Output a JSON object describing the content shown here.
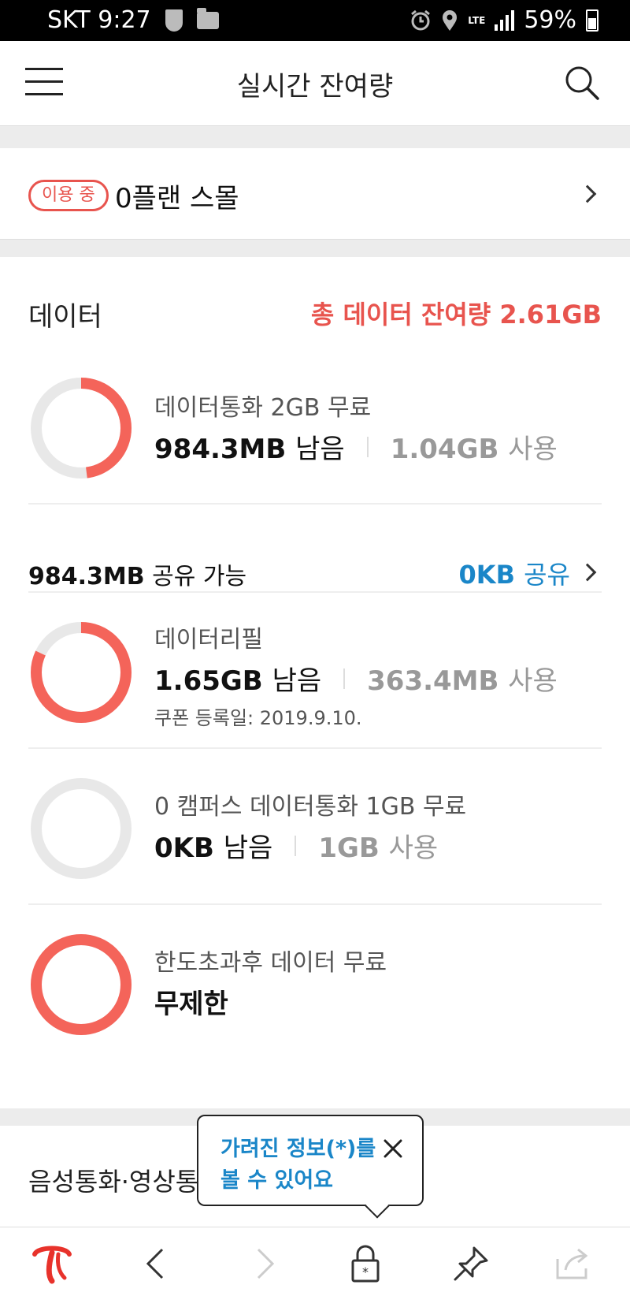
{
  "status_bar": {
    "carrier": "SKT",
    "time": "9:27",
    "network": "LTE",
    "battery": "59%",
    "icons": [
      "shield-icon",
      "folder-icon",
      "alarm-icon",
      "location-icon",
      "signal-icon",
      "battery-icon"
    ]
  },
  "header": {
    "title": "실시간 잔여량",
    "menu_icon": "menu-icon",
    "search_icon": "search-icon"
  },
  "plan": {
    "badge": "이용 중",
    "name": "0플랜 스몰"
  },
  "data": {
    "section_title": "데이터",
    "total_remaining": "총 데이터 잔여량 2.61GB",
    "items": [
      {
        "name": "데이터통화 2GB 무료",
        "remaining": "984.3MB",
        "remaining_suffix": "남음",
        "used": "1.04GB",
        "used_suffix": "사용",
        "remaining_fraction": 0.48
      },
      {
        "name": "데이터리필",
        "remaining": "1.65GB",
        "remaining_suffix": "남음",
        "used": "363.4MB",
        "used_suffix": "사용",
        "coupon": "쿠폰 등록일: 2019.9.10.",
        "remaining_fraction": 0.82
      },
      {
        "name": "0 캠퍼스 데이터통화 1GB 무료",
        "remaining": "0KB",
        "remaining_suffix": "남음",
        "used": "1GB",
        "used_suffix": "사용",
        "remaining_fraction": 0
      },
      {
        "name": "한도초과후 데이터 무료",
        "remaining": "무제한",
        "remaining_fraction": 1
      }
    ],
    "share": {
      "available": "984.3MB",
      "available_suffix": "공유 가능",
      "link_value": "0KB",
      "link_suffix": "공유"
    }
  },
  "voice": {
    "section_title": "음성통화·영상통화"
  },
  "tooltip": {
    "line1": "가려진 정보(*)를",
    "line2": "볼 수 있어요"
  },
  "bottom_bar": {
    "icons": [
      "tworld-logo-icon",
      "back-arrow-icon",
      "forward-arrow-icon",
      "lock-icon",
      "pin-icon",
      "share-icon"
    ]
  },
  "colors": {
    "accent_red": "#e8544e",
    "ring_fill": "#f4645a",
    "ring_track": "#e8e8e8",
    "link_blue": "#1a86c8"
  }
}
